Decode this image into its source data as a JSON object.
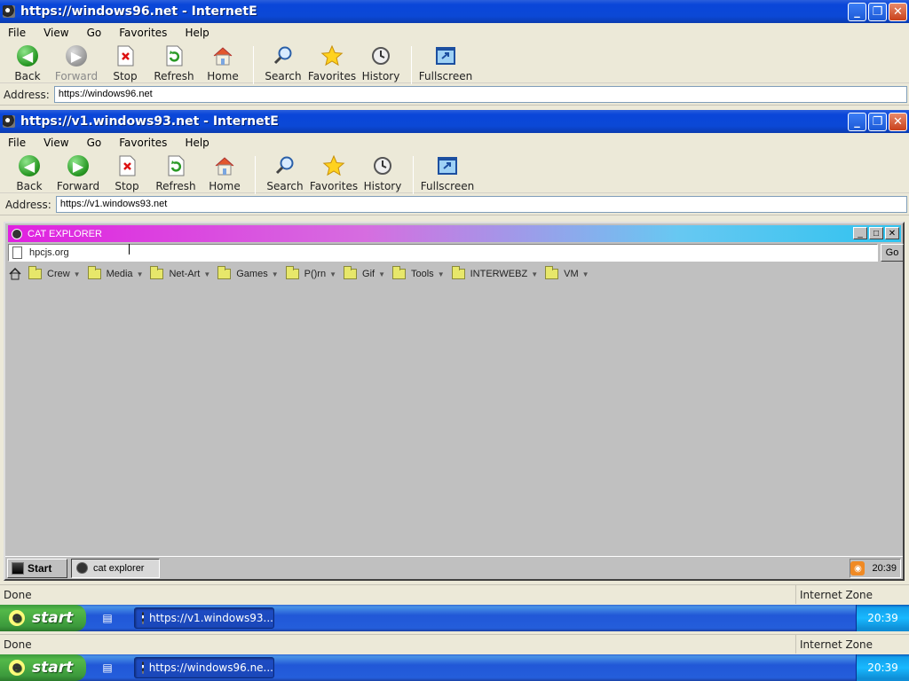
{
  "outer": {
    "title": "https://windows96.net - InternetE",
    "menu": [
      "File",
      "View",
      "Go",
      "Favorites",
      "Help"
    ],
    "toolbar": {
      "back": "Back",
      "forward": "Forward",
      "stop": "Stop",
      "refresh": "Refresh",
      "home": "Home",
      "search": "Search",
      "favorites": "Favorites",
      "history": "History",
      "fullscreen": "Fullscreen"
    },
    "address_label": "Address:",
    "address_value": "https://windows96.net",
    "status_left": "Done",
    "status_right": "Internet Zone",
    "taskbar": {
      "start": "start",
      "task": "https://windows96.ne...",
      "clock": "20:39"
    }
  },
  "inner": {
    "title": "https://v1.windows93.net - InternetE",
    "menu": [
      "File",
      "View",
      "Go",
      "Favorites",
      "Help"
    ],
    "toolbar": {
      "back": "Back",
      "forward": "Forward",
      "stop": "Stop",
      "refresh": "Refresh",
      "home": "Home",
      "search": "Search",
      "favorites": "Favorites",
      "history": "History",
      "fullscreen": "Fullscreen"
    },
    "address_label": "Address:",
    "address_value": "https://v1.windows93.net",
    "status_left": "Done",
    "status_right": "Internet Zone",
    "taskbar": {
      "start": "start",
      "task": "https://v1.windows93...",
      "clock": "20:39"
    }
  },
  "cat_explorer": {
    "title": "CAT EXPLORER",
    "url": "hpcjs.org",
    "go": "Go",
    "bookmarks": [
      "Crew",
      "Media",
      "Net-Art",
      "Games",
      "P()rn",
      "Gif",
      "Tools",
      "INTERWEBZ",
      "VM"
    ],
    "taskbar": {
      "start": "Start",
      "task": "cat explorer",
      "clock": "20:39"
    }
  },
  "colors": {
    "xp_blue": "#0a46d9",
    "xp_green": "#3c9a3c",
    "cat_gradient_start": "#e020e0",
    "cat_gradient_end": "#2fc3ef"
  }
}
